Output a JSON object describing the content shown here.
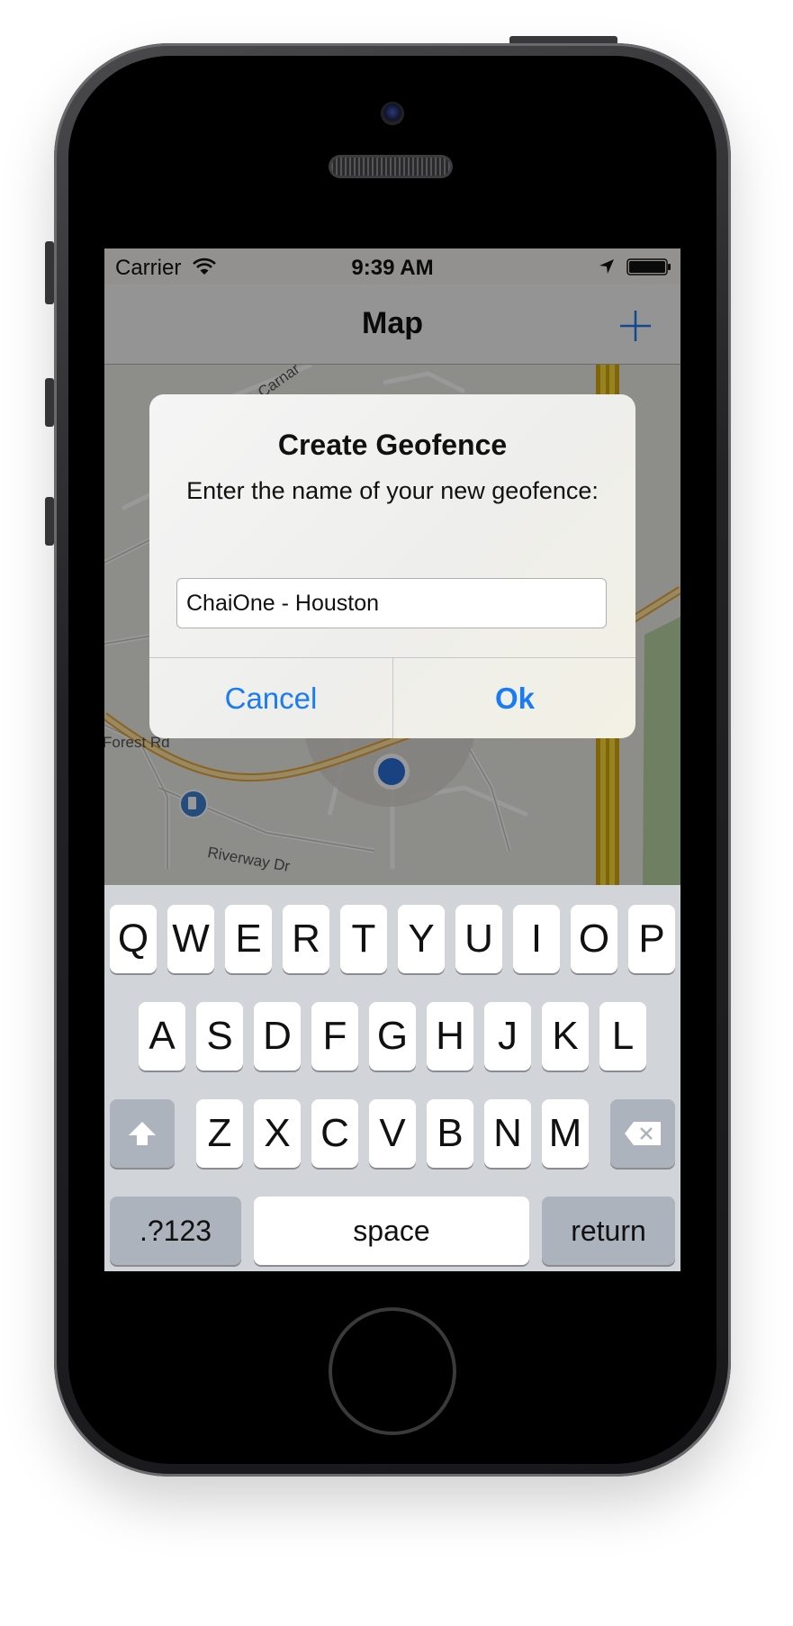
{
  "status_bar": {
    "carrier": "Carrier",
    "time": "9:39 AM"
  },
  "nav": {
    "title": "Map",
    "add_icon": "plus-icon"
  },
  "map": {
    "labels": [
      "Forest Rd",
      "Riverway Dr"
    ],
    "partial_label": "Carnar"
  },
  "alert": {
    "title": "Create Geofence",
    "message": "Enter the name of your new geofence:",
    "input_value": "ChaiOne - Houston",
    "cancel_label": "Cancel",
    "ok_label": "Ok"
  },
  "keyboard": {
    "row1": [
      "Q",
      "W",
      "E",
      "R",
      "T",
      "Y",
      "U",
      "I",
      "O",
      "P"
    ],
    "row2": [
      "A",
      "S",
      "D",
      "F",
      "G",
      "H",
      "J",
      "K",
      "L"
    ],
    "row3": [
      "Z",
      "X",
      "C",
      "V",
      "B",
      "N",
      "M"
    ],
    "numbers_label": ".?123",
    "space_label": "space",
    "return_label": "return",
    "shift_icon": "shift-icon",
    "delete_icon": "delete-icon"
  },
  "colors": {
    "accent": "#1a7cf5",
    "keyboard_bg": "#d1d4d9",
    "road": "#f0b43a"
  }
}
